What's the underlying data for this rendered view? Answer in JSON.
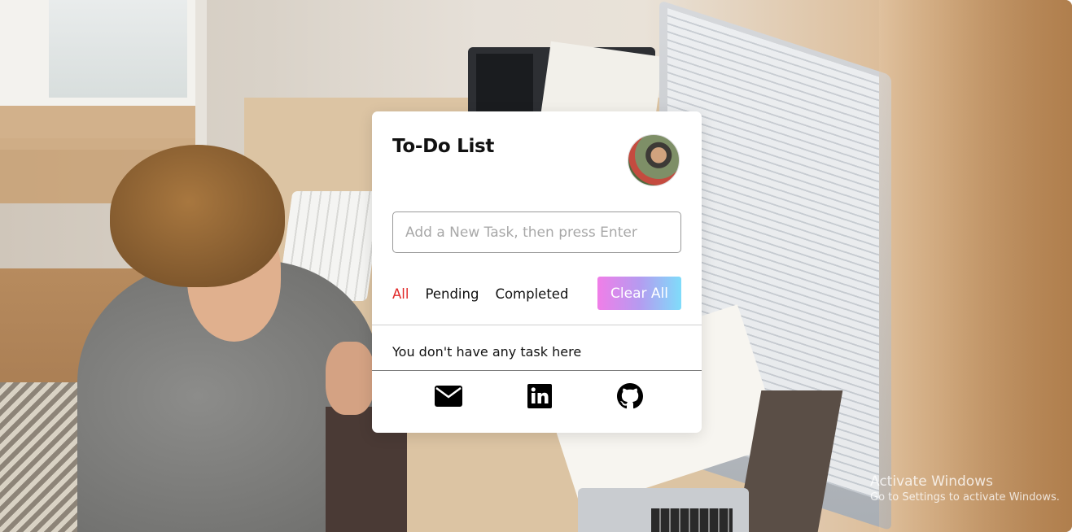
{
  "todo": {
    "title": "To-Do List",
    "input_placeholder": "Add a New Task, then press Enter",
    "filters": [
      {
        "label": "All",
        "active": true
      },
      {
        "label": "Pending",
        "active": false
      },
      {
        "label": "Completed",
        "active": false
      }
    ],
    "clear_all_label": "Clear All",
    "empty_message": "You don't have any task here",
    "active_filter_color": "#e12b2b",
    "clear_button_gradient": [
      "#f07ee8",
      "#b59bf0",
      "#7fdcfa"
    ]
  },
  "social": [
    {
      "icon": "mail-icon"
    },
    {
      "icon": "linkedin-icon"
    },
    {
      "icon": "github-icon"
    }
  ],
  "watermark": {
    "line1": "Activate Windows",
    "line2": "Go to Settings to activate Windows."
  }
}
